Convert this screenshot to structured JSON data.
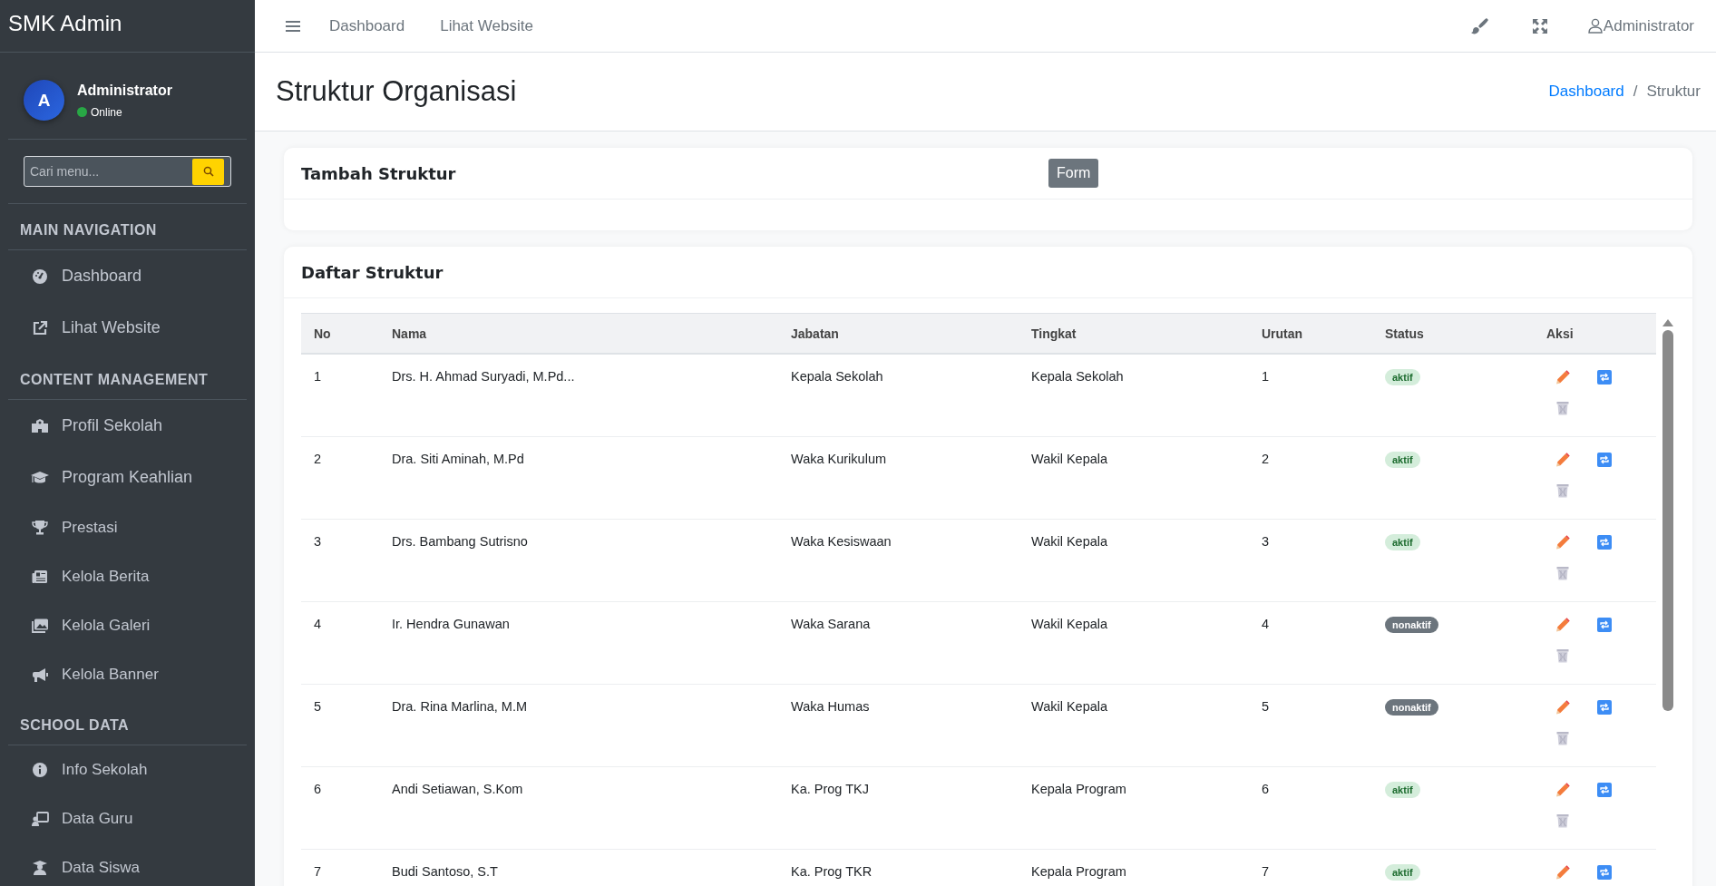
{
  "sidebar": {
    "brand": "SMK Admin",
    "user": {
      "initial": "A",
      "name": "Administrator",
      "status": "Online",
      "online": true
    },
    "search": {
      "placeholder": "Cari menu..."
    },
    "sections": [
      {
        "title": "MAIN NAVIGATION",
        "items": [
          {
            "label": "Dashboard"
          },
          {
            "label": "Lihat Website"
          }
        ]
      },
      {
        "title": "CONTENT MANAGEMENT",
        "items": [
          {
            "label": "Profil Sekolah"
          },
          {
            "label": "Program Keahlian"
          },
          {
            "label": "Prestasi"
          },
          {
            "label": "Kelola Berita"
          },
          {
            "label": "Kelola Galeri"
          },
          {
            "label": "Kelola Banner"
          }
        ]
      },
      {
        "title": "SCHOOL DATA",
        "items": [
          {
            "label": "Info Sekolah"
          },
          {
            "label": "Data Guru"
          },
          {
            "label": "Data Siswa"
          }
        ]
      }
    ]
  },
  "topbar": {
    "links": [
      "Dashboard",
      "Lihat Website"
    ],
    "user": "Administrator"
  },
  "page": {
    "title": "Struktur Organisasi",
    "breadcrumb_separator": "/",
    "breadcrumb": [
      {
        "label": "Dashboard",
        "link": true
      },
      {
        "label": "Struktur",
        "link": false
      }
    ]
  },
  "form_card": {
    "title": "Tambah Struktur",
    "button": "Form"
  },
  "list_card": {
    "title": "Daftar Struktur",
    "table": {
      "columns": [
        "No",
        "Nama",
        "Jabatan",
        "Tingkat",
        "Urutan",
        "Status",
        "Aksi"
      ],
      "rows": [
        {
          "no": "1",
          "nama": "Drs. H. Ahmad Suryadi, M.Pd...",
          "jabatan": "Kepala Sekolah",
          "tingkat": "Kepala Sekolah",
          "urutan": "1",
          "status": "aktif",
          "active": true
        },
        {
          "no": "2",
          "nama": "Dra. Siti Aminah, M.Pd",
          "jabatan": "Waka Kurikulum",
          "tingkat": "Wakil Kepala",
          "urutan": "2",
          "status": "aktif",
          "active": true
        },
        {
          "no": "3",
          "nama": "Drs. Bambang Sutrisno",
          "jabatan": "Waka Kesiswaan",
          "tingkat": "Wakil Kepala",
          "urutan": "3",
          "status": "aktif",
          "active": true
        },
        {
          "no": "4",
          "nama": "Ir. Hendra Gunawan",
          "jabatan": "Waka Sarana",
          "tingkat": "Wakil Kepala",
          "urutan": "4",
          "status": "nonaktif",
          "active": false
        },
        {
          "no": "5",
          "nama": "Dra. Rina Marlina, M.M",
          "jabatan": "Waka Humas",
          "tingkat": "Wakil Kepala",
          "urutan": "5",
          "status": "nonaktif",
          "active": false
        },
        {
          "no": "6",
          "nama": "Andi Setiawan, S.Kom",
          "jabatan": "Ka. Prog TKJ",
          "tingkat": "Kepala Program",
          "urutan": "6",
          "status": "aktif",
          "active": true
        },
        {
          "no": "7",
          "nama": "Budi Santoso, S.T",
          "jabatan": "Ka. Prog TKR",
          "tingkat": "Kepala Program",
          "urutan": "7",
          "status": "aktif",
          "active": true
        }
      ]
    }
  }
}
